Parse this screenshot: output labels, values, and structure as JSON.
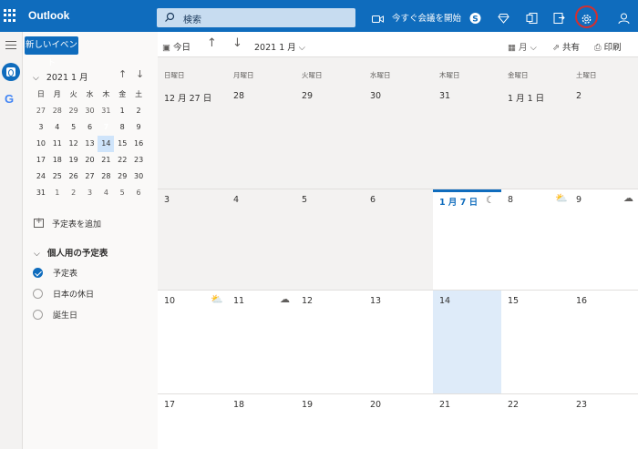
{
  "app": {
    "title": "Outlook"
  },
  "search": {
    "placeholder": "検索"
  },
  "topbar": {
    "meet_now": "今すぐ会議を開始"
  },
  "sidebar": {
    "new_event": "新しいイベント",
    "month_label": "2021 1 月",
    "weekdays": [
      "日",
      "月",
      "火",
      "水",
      "木",
      "金",
      "土"
    ],
    "weeks": [
      [
        "27",
        "28",
        "29",
        "30",
        "31",
        "1",
        "2"
      ],
      [
        "3",
        "4",
        "5",
        "6",
        "7",
        "8",
        "9"
      ],
      [
        "10",
        "11",
        "12",
        "13",
        "14",
        "15",
        "16"
      ],
      [
        "17",
        "18",
        "19",
        "20",
        "21",
        "22",
        "23"
      ],
      [
        "24",
        "25",
        "26",
        "27",
        "28",
        "29",
        "30"
      ],
      [
        "31",
        "1",
        "2",
        "3",
        "4",
        "5",
        "6"
      ]
    ],
    "add_calendar": "予定表を追加",
    "personal_group": "個人用の予定表",
    "calendars": [
      {
        "label": "予定表",
        "checked": true
      },
      {
        "label": "日本の休日",
        "checked": false
      },
      {
        "label": "誕生日",
        "checked": false
      }
    ]
  },
  "commandbar": {
    "today": "今日",
    "month_title": "2021 1 月",
    "view_month": "月",
    "share": "共有",
    "print": "印刷"
  },
  "calendar": {
    "day_headers": [
      "日曜日",
      "月曜日",
      "火曜日",
      "水曜日",
      "木曜日",
      "金曜日",
      "土曜日"
    ],
    "weeks": [
      [
        "12 月 27 日",
        "28",
        "29",
        "30",
        "31",
        "1 月 1 日",
        "2"
      ],
      [
        "3",
        "4",
        "5",
        "6",
        "1 月 7 日",
        "8",
        "9"
      ],
      [
        "10",
        "11",
        "12",
        "13",
        "14",
        "15",
        "16"
      ],
      [
        "17",
        "18",
        "19",
        "20",
        "21",
        "22",
        "23"
      ]
    ],
    "weather_icons": [
      "moon-icon",
      "partly-cloudy-icon",
      "rain-cloud-icon",
      "partly-cloudy-icon",
      "cloud-icon"
    ]
  },
  "colors": {
    "brand": "#0f6cbd",
    "selected": "#deebf9",
    "highlight": "#d32f2f"
  }
}
